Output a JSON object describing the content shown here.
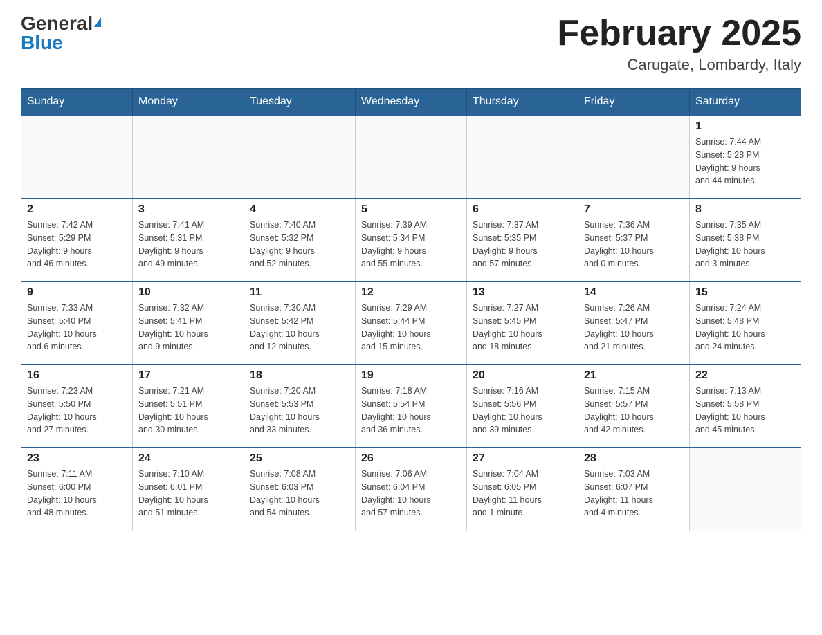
{
  "header": {
    "logo_general": "General",
    "logo_blue": "Blue",
    "month_title": "February 2025",
    "location": "Carugate, Lombardy, Italy"
  },
  "days_of_week": [
    "Sunday",
    "Monday",
    "Tuesday",
    "Wednesday",
    "Thursday",
    "Friday",
    "Saturday"
  ],
  "weeks": [
    [
      {
        "day": "",
        "info": ""
      },
      {
        "day": "",
        "info": ""
      },
      {
        "day": "",
        "info": ""
      },
      {
        "day": "",
        "info": ""
      },
      {
        "day": "",
        "info": ""
      },
      {
        "day": "",
        "info": ""
      },
      {
        "day": "1",
        "info": "Sunrise: 7:44 AM\nSunset: 5:28 PM\nDaylight: 9 hours\nand 44 minutes."
      }
    ],
    [
      {
        "day": "2",
        "info": "Sunrise: 7:42 AM\nSunset: 5:29 PM\nDaylight: 9 hours\nand 46 minutes."
      },
      {
        "day": "3",
        "info": "Sunrise: 7:41 AM\nSunset: 5:31 PM\nDaylight: 9 hours\nand 49 minutes."
      },
      {
        "day": "4",
        "info": "Sunrise: 7:40 AM\nSunset: 5:32 PM\nDaylight: 9 hours\nand 52 minutes."
      },
      {
        "day": "5",
        "info": "Sunrise: 7:39 AM\nSunset: 5:34 PM\nDaylight: 9 hours\nand 55 minutes."
      },
      {
        "day": "6",
        "info": "Sunrise: 7:37 AM\nSunset: 5:35 PM\nDaylight: 9 hours\nand 57 minutes."
      },
      {
        "day": "7",
        "info": "Sunrise: 7:36 AM\nSunset: 5:37 PM\nDaylight: 10 hours\nand 0 minutes."
      },
      {
        "day": "8",
        "info": "Sunrise: 7:35 AM\nSunset: 5:38 PM\nDaylight: 10 hours\nand 3 minutes."
      }
    ],
    [
      {
        "day": "9",
        "info": "Sunrise: 7:33 AM\nSunset: 5:40 PM\nDaylight: 10 hours\nand 6 minutes."
      },
      {
        "day": "10",
        "info": "Sunrise: 7:32 AM\nSunset: 5:41 PM\nDaylight: 10 hours\nand 9 minutes."
      },
      {
        "day": "11",
        "info": "Sunrise: 7:30 AM\nSunset: 5:42 PM\nDaylight: 10 hours\nand 12 minutes."
      },
      {
        "day": "12",
        "info": "Sunrise: 7:29 AM\nSunset: 5:44 PM\nDaylight: 10 hours\nand 15 minutes."
      },
      {
        "day": "13",
        "info": "Sunrise: 7:27 AM\nSunset: 5:45 PM\nDaylight: 10 hours\nand 18 minutes."
      },
      {
        "day": "14",
        "info": "Sunrise: 7:26 AM\nSunset: 5:47 PM\nDaylight: 10 hours\nand 21 minutes."
      },
      {
        "day": "15",
        "info": "Sunrise: 7:24 AM\nSunset: 5:48 PM\nDaylight: 10 hours\nand 24 minutes."
      }
    ],
    [
      {
        "day": "16",
        "info": "Sunrise: 7:23 AM\nSunset: 5:50 PM\nDaylight: 10 hours\nand 27 minutes."
      },
      {
        "day": "17",
        "info": "Sunrise: 7:21 AM\nSunset: 5:51 PM\nDaylight: 10 hours\nand 30 minutes."
      },
      {
        "day": "18",
        "info": "Sunrise: 7:20 AM\nSunset: 5:53 PM\nDaylight: 10 hours\nand 33 minutes."
      },
      {
        "day": "19",
        "info": "Sunrise: 7:18 AM\nSunset: 5:54 PM\nDaylight: 10 hours\nand 36 minutes."
      },
      {
        "day": "20",
        "info": "Sunrise: 7:16 AM\nSunset: 5:56 PM\nDaylight: 10 hours\nand 39 minutes."
      },
      {
        "day": "21",
        "info": "Sunrise: 7:15 AM\nSunset: 5:57 PM\nDaylight: 10 hours\nand 42 minutes."
      },
      {
        "day": "22",
        "info": "Sunrise: 7:13 AM\nSunset: 5:58 PM\nDaylight: 10 hours\nand 45 minutes."
      }
    ],
    [
      {
        "day": "23",
        "info": "Sunrise: 7:11 AM\nSunset: 6:00 PM\nDaylight: 10 hours\nand 48 minutes."
      },
      {
        "day": "24",
        "info": "Sunrise: 7:10 AM\nSunset: 6:01 PM\nDaylight: 10 hours\nand 51 minutes."
      },
      {
        "day": "25",
        "info": "Sunrise: 7:08 AM\nSunset: 6:03 PM\nDaylight: 10 hours\nand 54 minutes."
      },
      {
        "day": "26",
        "info": "Sunrise: 7:06 AM\nSunset: 6:04 PM\nDaylight: 10 hours\nand 57 minutes."
      },
      {
        "day": "27",
        "info": "Sunrise: 7:04 AM\nSunset: 6:05 PM\nDaylight: 11 hours\nand 1 minute."
      },
      {
        "day": "28",
        "info": "Sunrise: 7:03 AM\nSunset: 6:07 PM\nDaylight: 11 hours\nand 4 minutes."
      },
      {
        "day": "",
        "info": ""
      }
    ]
  ]
}
